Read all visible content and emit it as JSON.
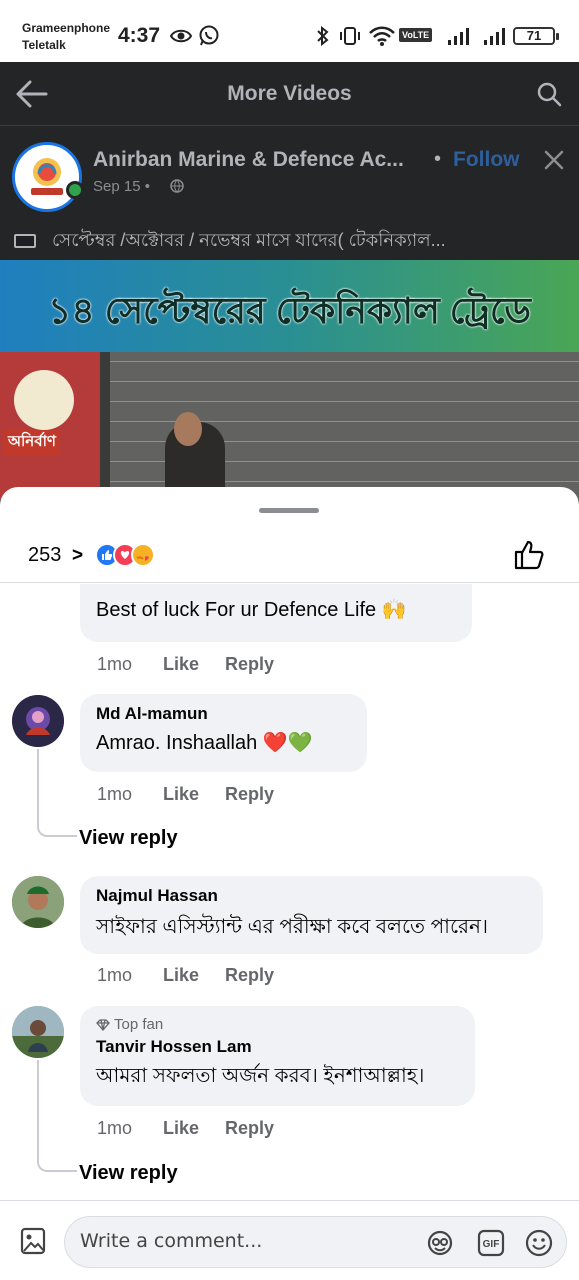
{
  "status_bar": {
    "carrier_1": "Grameenphone",
    "carrier_2": "Teletalk",
    "time": "4:37",
    "volte": "VoLTE",
    "battery": "71"
  },
  "header": {
    "title": "More Videos"
  },
  "post": {
    "page_name": "Anirban Marine & Defence Ac...",
    "separator": "•",
    "follow_label": "Follow",
    "date": "Sep 15 •",
    "caption": "সেপ্টেম্বর /অক্টোবর / নভেম্বর  মাসে  যাদের( টেকনিক্যাল...",
    "video_banner_text": "১৪ সেপ্টেম্বরের টেকনিক্যাল ট্রেডে",
    "logo_text": "অনির্বাণ"
  },
  "reactions": {
    "count": "253",
    "chevron": ">"
  },
  "comments": [
    {
      "text": "Best of luck For ur Defence Life 🙌",
      "time": "1mo",
      "like_label": "Like",
      "reply_label": "Reply"
    },
    {
      "name": "Md Al-mamun",
      "text": "Amrao. Inshaallah ❤️💚",
      "time": "1mo",
      "like_label": "Like",
      "reply_label": "Reply",
      "view_reply": "View reply"
    },
    {
      "name": "Najmul Hassan",
      "text": "সাইফার এসিস্ট্যান্ট এর পরীক্ষা কবে বলতে পারেন।",
      "time": "1mo",
      "like_label": "Like",
      "reply_label": "Reply"
    },
    {
      "badge": "Top fan",
      "name": "Tanvir Hossen Lam",
      "text": "আমরা সফলতা অর্জন করব। ইনশাআল্লাহ।",
      "time": "1mo",
      "like_label": "Like",
      "reply_label": "Reply",
      "view_reply": "View reply"
    }
  ],
  "composer": {
    "placeholder": "Write a comment..."
  },
  "colors": {
    "facebook_blue": "#1b74e4",
    "like_blue": "#2078f4",
    "love_red": "#f33e58",
    "care_yellow": "#f7b125"
  }
}
